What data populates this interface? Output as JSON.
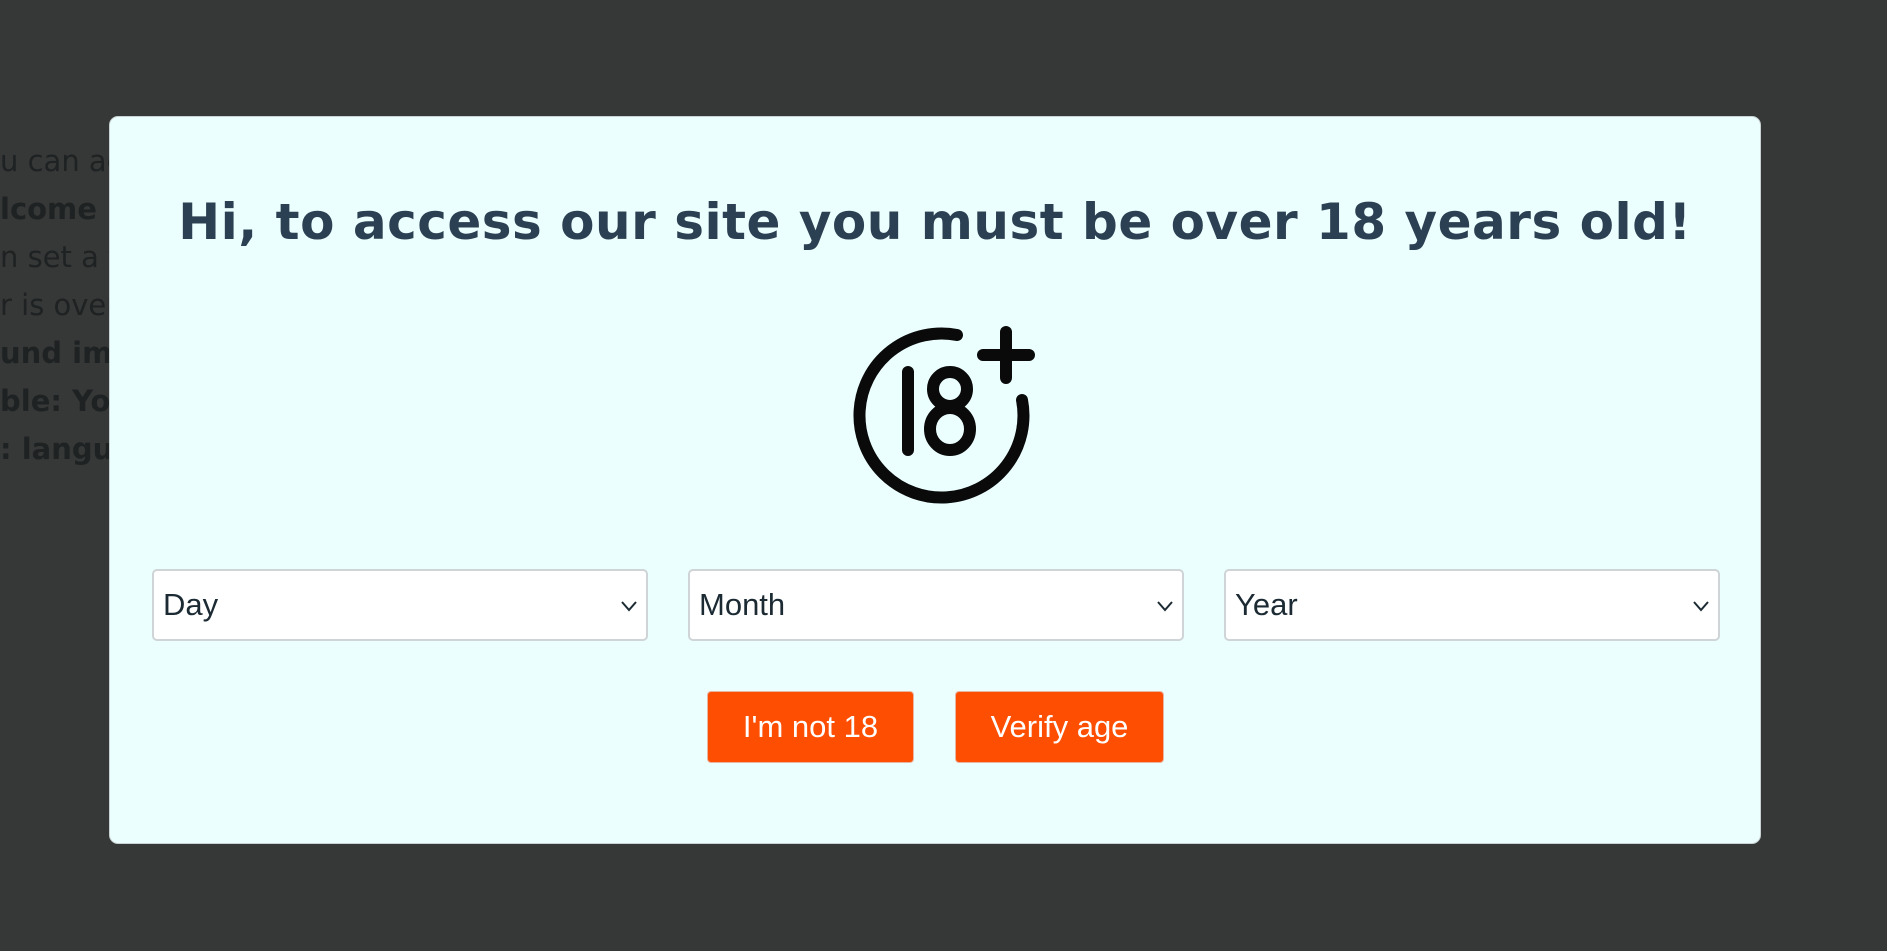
{
  "background_text": {
    "lines": [
      {
        "text": "u can ac",
        "bold": false
      },
      {
        "text": "lcome m",
        "bold": true
      },
      {
        "text": "n set a f",
        "bold": false
      },
      {
        "text": "r is over",
        "bold": false
      },
      {
        "text": "und ima",
        "bold": true
      },
      {
        "text": "ble: You",
        "bold": true
      },
      {
        "text": ": langua",
        "bold": true
      }
    ]
  },
  "modal": {
    "title": "Hi, to access our site you must be over 18 years old!",
    "icon": "18-plus-icon",
    "selects": {
      "day": {
        "value": "Day"
      },
      "month": {
        "value": "Month"
      },
      "year": {
        "value": "Year"
      }
    },
    "buttons": {
      "not_18": "I'm not 18",
      "verify": "Verify age"
    }
  },
  "colors": {
    "overlay": "#363737",
    "modal_bg": "#ecffff",
    "title": "#2b4052",
    "button": "#fe4e02"
  }
}
